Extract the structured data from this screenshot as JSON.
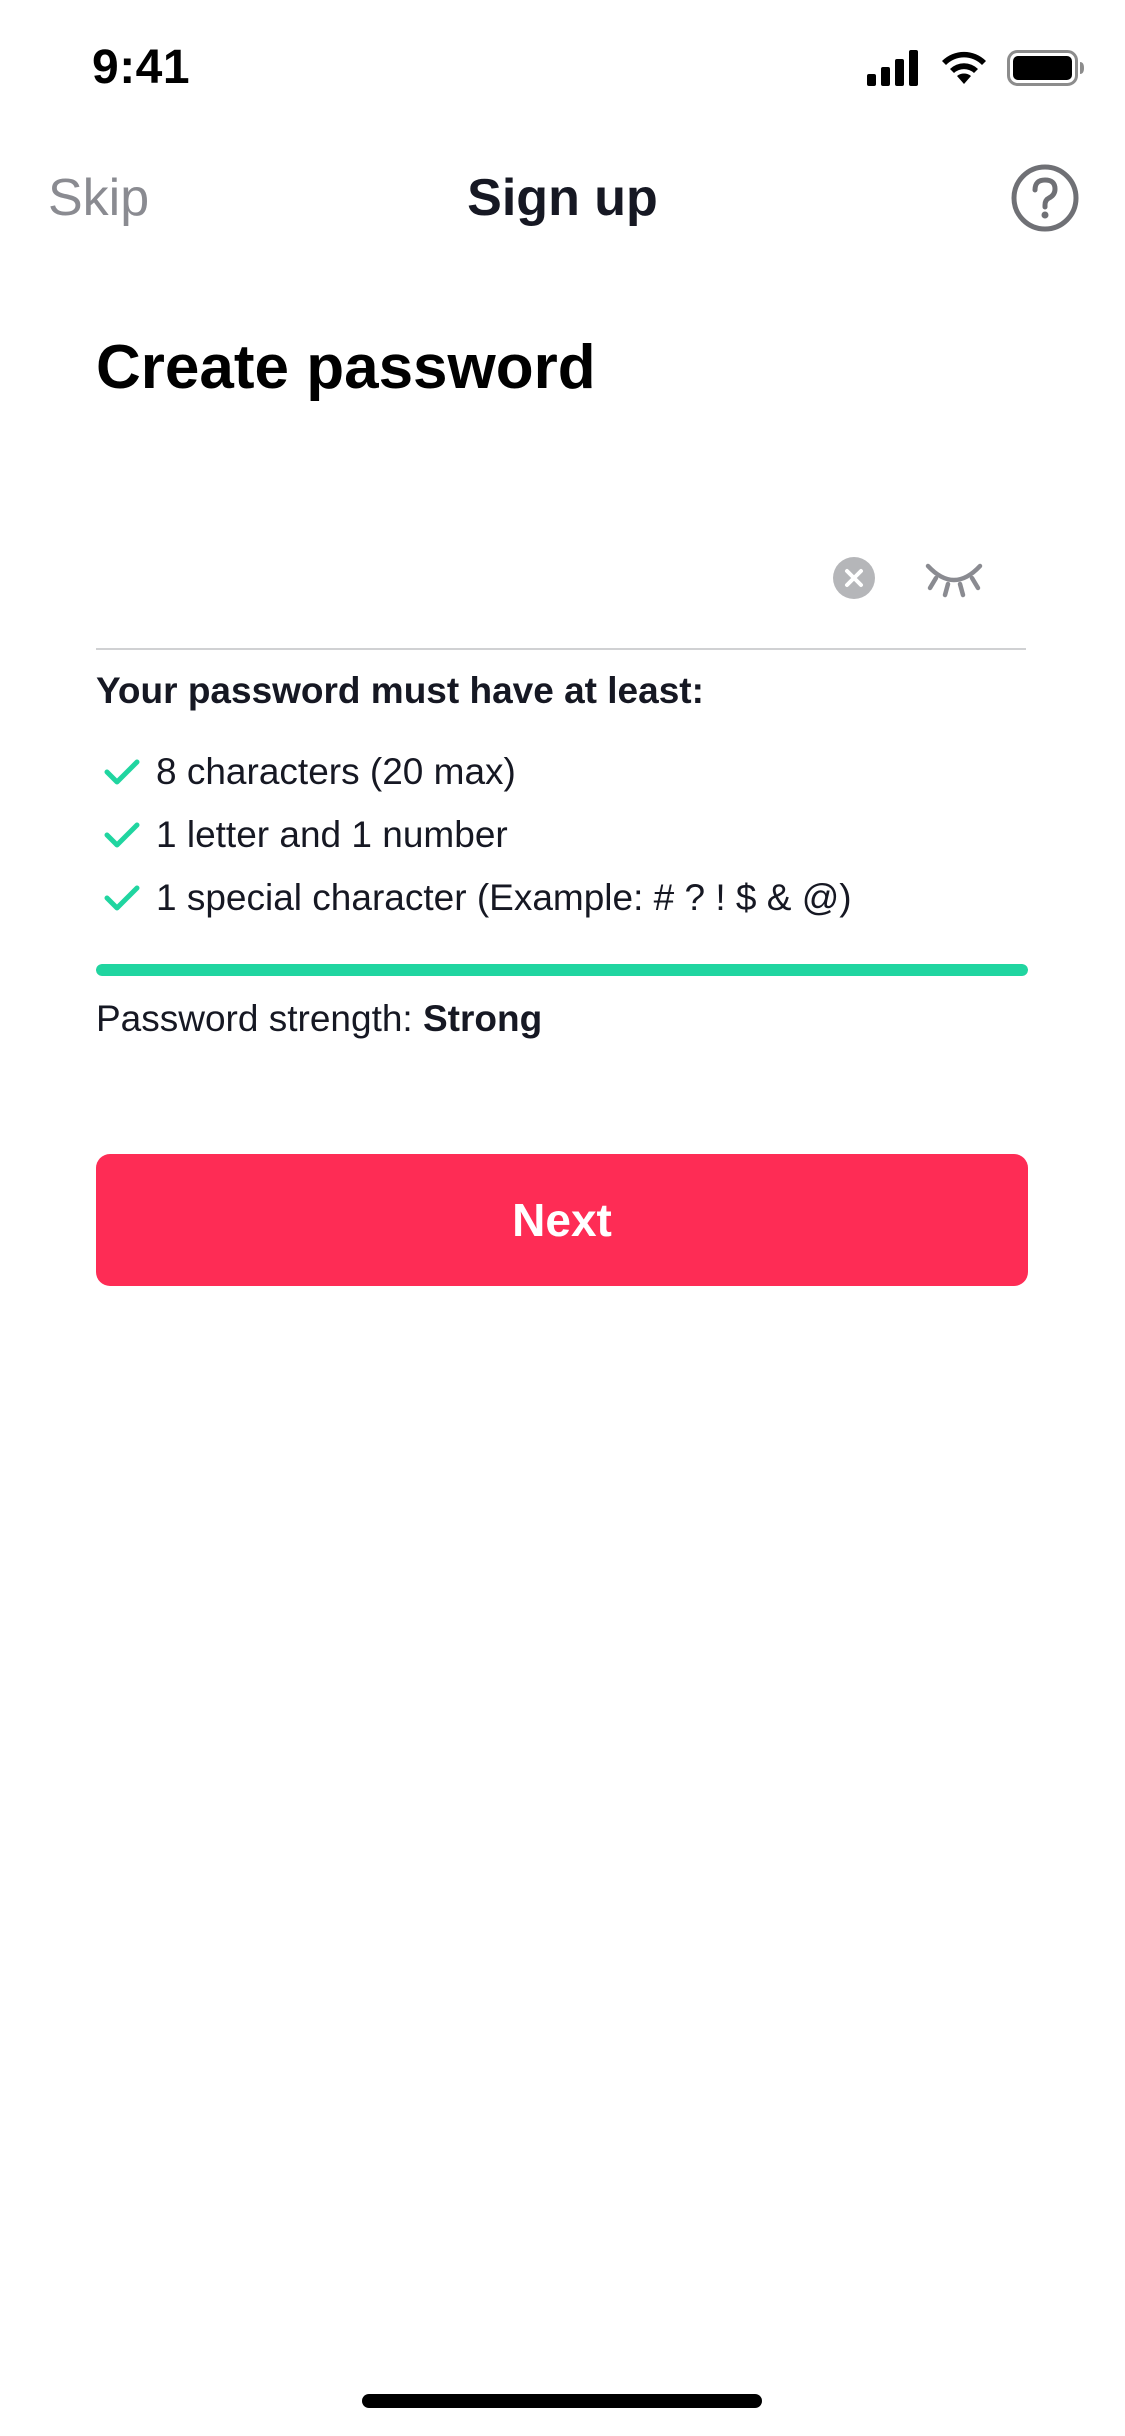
{
  "status_bar": {
    "time": "9:41",
    "icons": [
      "cellular-signal-icon",
      "wifi-icon",
      "battery-icon"
    ]
  },
  "nav": {
    "skip_label": "Skip",
    "title": "Sign up",
    "help_icon": "question-circle-icon"
  },
  "page": {
    "title": "Create password"
  },
  "password_field": {
    "value": "",
    "clear_icon": "clear-circle-icon",
    "visibility_icon": "eye-closed-icon"
  },
  "rules": {
    "heading": "Your password must have at least:",
    "items": [
      {
        "label": "8 characters (20 max)",
        "met": true
      },
      {
        "label": "1 letter and 1 number",
        "met": true
      },
      {
        "label": "1 special character (Example: # ? ! $ & @)",
        "met": true
      }
    ]
  },
  "strength": {
    "label": "Password strength: ",
    "value": "Strong",
    "fill_fraction": 1.0
  },
  "next_button": {
    "label": "Next"
  },
  "colors": {
    "accent": "#fe2c55",
    "success": "#20d5a0",
    "muted": "#8a8b91"
  }
}
